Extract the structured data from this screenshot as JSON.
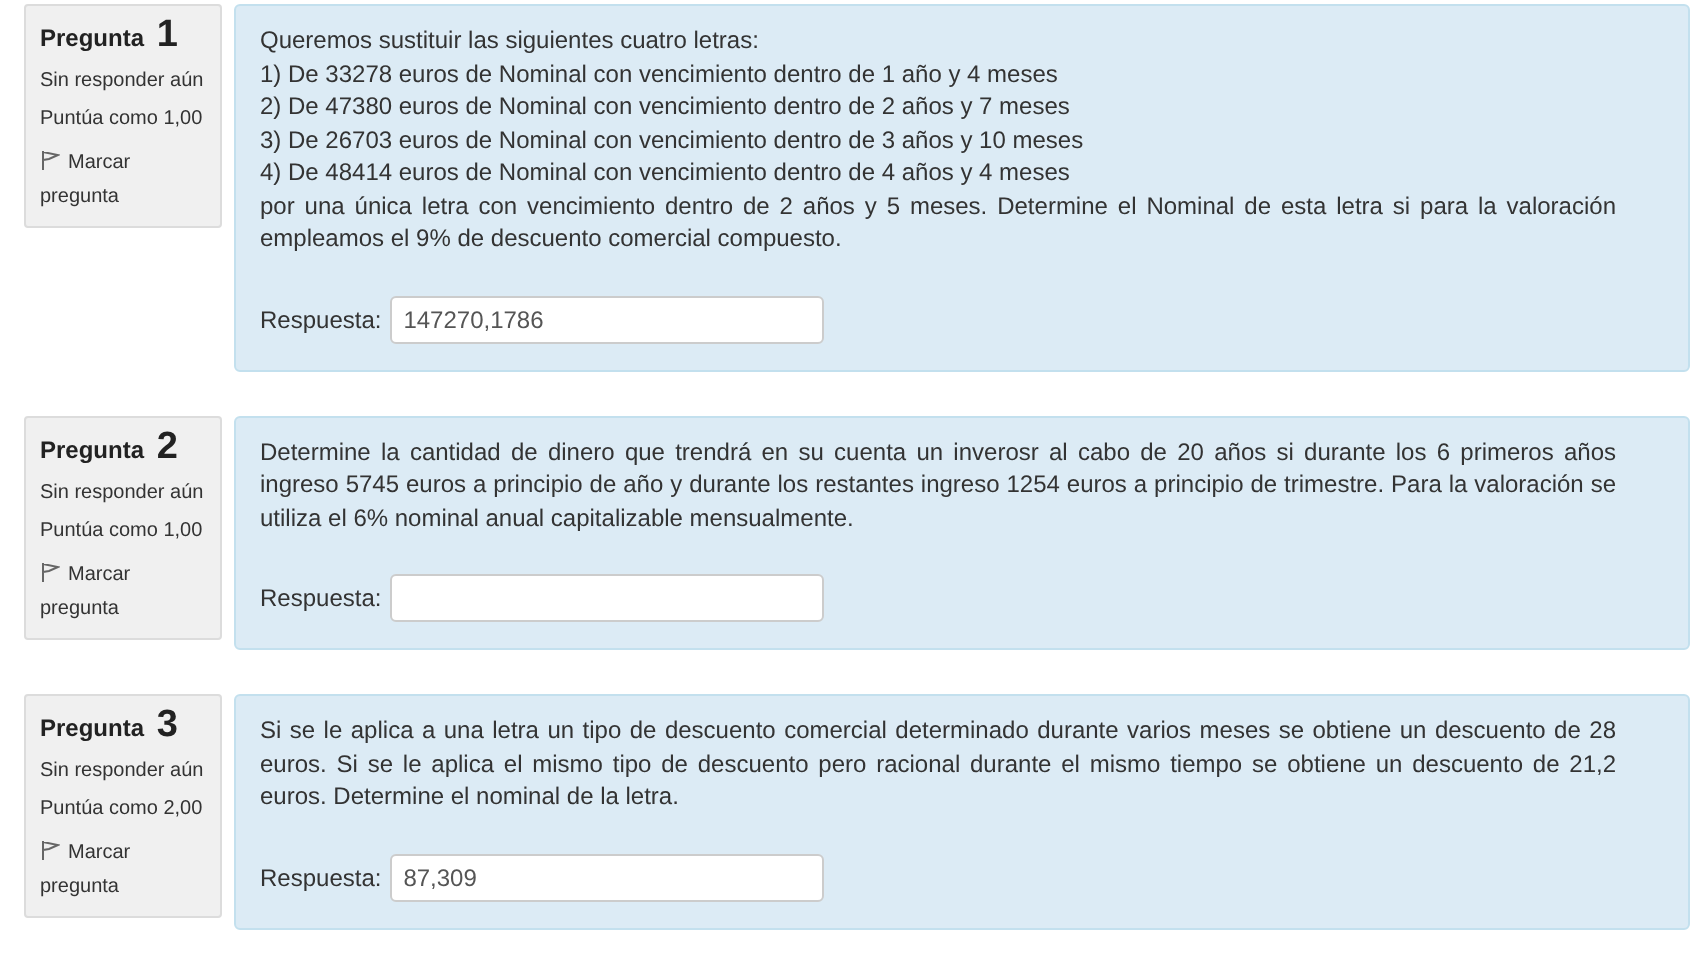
{
  "questions": [
    {
      "label": "Pregunta",
      "number": "1",
      "status": "Sin responder aún",
      "score": "Puntúa como 1,00",
      "flag": "Marcar pregunta",
      "paragraphs": [
        "Queremos sustituir las siguientes cuatro letras:",
        "1) De 33278 euros de Nominal con vencimiento dentro de 1 año y 4 meses",
        "2) De 47380 euros de Nominal con vencimiento dentro de 2 años y 7 meses",
        "3) De 26703 euros de Nominal con vencimiento dentro de 3 años y 10 meses",
        "4) De 48414 euros de Nominal con vencimiento dentro de 4 años y 4 meses",
        "por una única letra con vencimiento dentro de 2 años y 5 meses. Determine el Nominal de esta letra si para la valoración empleamos el 9% de descuento comercial compuesto."
      ],
      "answer_label": "Respuesta:",
      "answer": "147270,1786"
    },
    {
      "label": "Pregunta",
      "number": "2",
      "status": "Sin responder aún",
      "score": "Puntúa como 1,00",
      "flag": "Marcar pregunta",
      "paragraphs": [
        "Determine la cantidad de dinero que trendrá en su cuenta un inverosr al cabo de 20 años si durante los 6 primeros años ingreso 5745 euros a principio de año y durante los restantes ingreso 1254 euros a principio de trimestre. Para la valoración se utiliza el 6% nominal anual capitalizable mensualmente."
      ],
      "answer_label": "Respuesta:"
    },
    {
      "label": "Pregunta",
      "number": "3",
      "status": "Sin responder aún",
      "score": "Puntúa como 2,00",
      "flag": "Marcar pregunta",
      "paragraphs": [
        "Si se le aplica a una letra un tipo de descuento comercial determinado durante varios meses se obtiene un descuento de 28 euros. Si se le aplica el mismo tipo de descuento pero racional durante el mismo tiempo se obtiene un descuento de 21,2 euros. Determine el nominal de la letra."
      ],
      "answer_label": "Respuesta:",
      "answer": "87,309"
    }
  ]
}
